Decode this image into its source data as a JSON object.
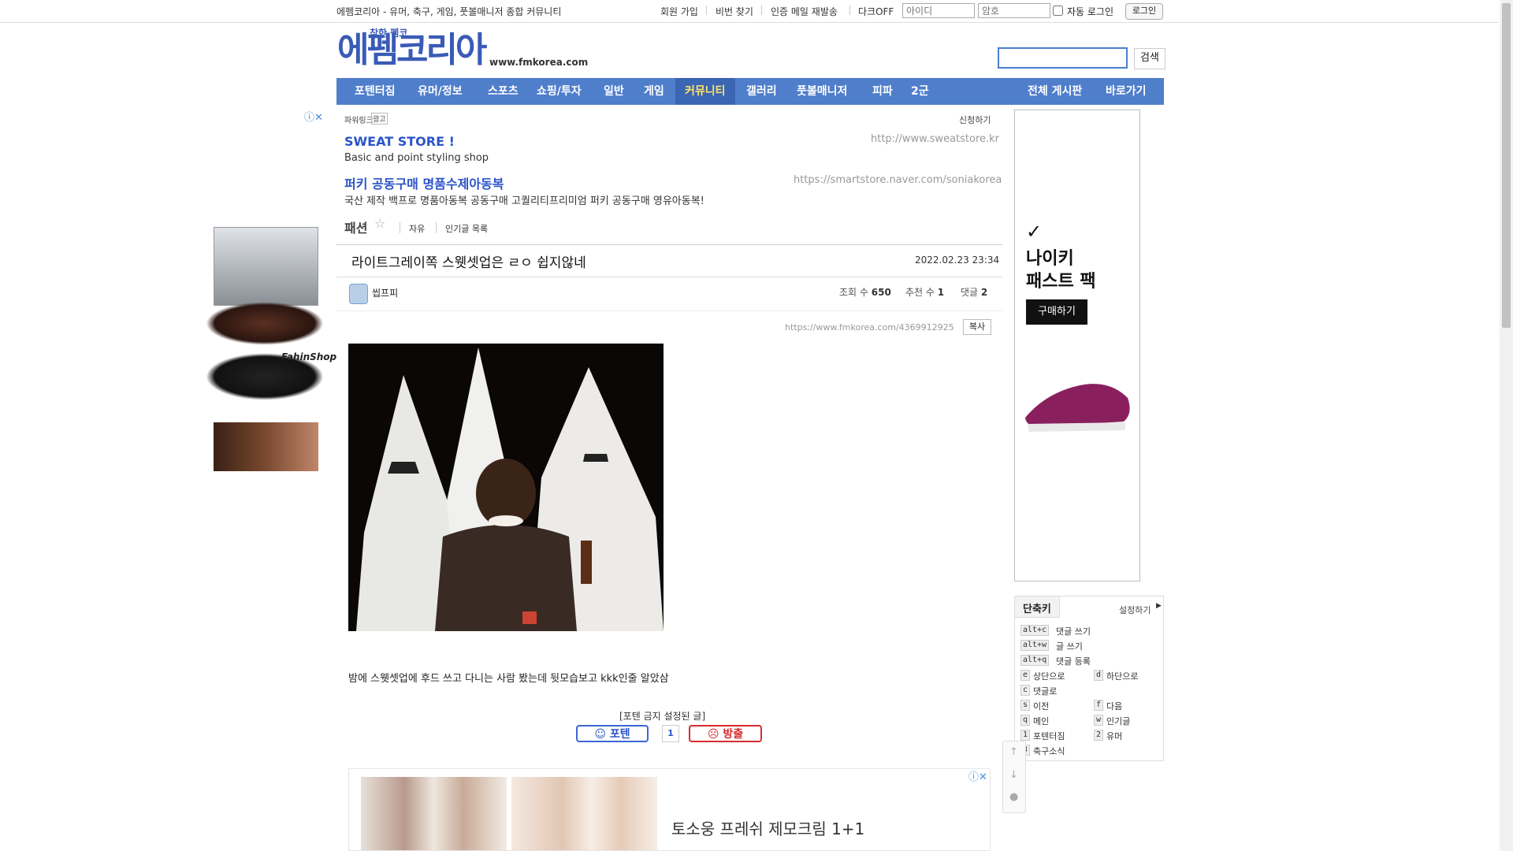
{
  "topbar": {
    "site_desc": "에펨코리아 - 유머, 축구, 게임, 풋볼매니저 종합 커뮤니티",
    "links": [
      "회원 가입",
      "비번 찾기",
      "인증 메일 재발송",
      "다크OFF"
    ],
    "id_placeholder": "아이디",
    "pw_placeholder": "암호",
    "auto_login": "자동 로그인",
    "login": "로그인"
  },
  "logo": {
    "sub": "착한 펨코",
    "main": "에펨코리아",
    "url": "www.fmkorea.com"
  },
  "search": {
    "button": "검색"
  },
  "nav": {
    "items": [
      "포텐터짐",
      "유머/정보",
      "스포츠",
      "쇼핑/투자",
      "일반",
      "게임",
      "커뮤니티",
      "갤러리",
      "풋볼매니저",
      "피파",
      "2군"
    ],
    "right": [
      "전체 게시판",
      "바로가기"
    ],
    "active": "커뮤니티",
    "active_color": "#ffe36a",
    "bar_color": "#4f7ecb"
  },
  "text_ads": {
    "label": "파워링크",
    "label_badge": "광고",
    "apply": "신청하기",
    "items": [
      {
        "title": "SWEAT STORE !",
        "desc": "Basic and point styling shop",
        "url": "http://www.sweatstore.kr"
      },
      {
        "title": "퍼키 공동구매 명품수제아동복",
        "desc": "국산 제작 백프로 명품아동복 공동구매 고퀄리티프리미엄 퍼키 공동구매 영유아동복!",
        "url": "https://smartstore.naver.com/soniakorea"
      }
    ]
  },
  "board": {
    "category": "패션",
    "links": [
      "자유",
      "인기글 목록"
    ]
  },
  "post": {
    "title": "라이트그레이쪽 스웻셋업은 ㄹㅇ 쉽지않네",
    "date": "2022.02.23 23:34",
    "author": "씹프피",
    "views_label": "조회 수",
    "views": "650",
    "recommend_label": "추천 수",
    "recommend": "1",
    "comments_label": "댓글",
    "comments": "2",
    "url": "https://www.fmkorea.com/4369912925",
    "copy": "복사",
    "body": "밤에 스웻셋업에 후드 쓰고 다니는 사람 봤는데 뒷모습보고 kkk인줄 알았삼",
    "vote_label": "[포텐 금지 설정된 글]",
    "vote_up": "포텐",
    "vote_count": "1",
    "vote_down": "방출"
  },
  "left_ad": {
    "brand": "FahinShop"
  },
  "right_ad": {
    "brand": "나이키",
    "headline": "패스트 팩",
    "cta": "구매하기"
  },
  "bottom_ad": {
    "text": "토소웅 프레쉬 제모크림 1+1"
  },
  "shortcut": {
    "title": "단축키",
    "settings": "설정하기",
    "items": [
      {
        "key": "alt+c",
        "label": "댓글 쓰기"
      },
      {
        "key": "alt+w",
        "label": "글 쓰기"
      },
      {
        "key": "alt+q",
        "label": "댓글 등록"
      },
      {
        "key": "e",
        "label": "상단으로"
      },
      {
        "key": "d",
        "label": "하단으로"
      },
      {
        "key": "c",
        "label": "댓글로"
      },
      {
        "key": "s",
        "label": "이전"
      },
      {
        "key": "f",
        "label": "다음"
      },
      {
        "key": "q",
        "label": "메인"
      },
      {
        "key": "w",
        "label": "인기글"
      },
      {
        "key": "1",
        "label": "포텐터짐"
      },
      {
        "key": "2",
        "label": "유머"
      },
      {
        "key": "3",
        "label": "축구소식"
      }
    ]
  }
}
